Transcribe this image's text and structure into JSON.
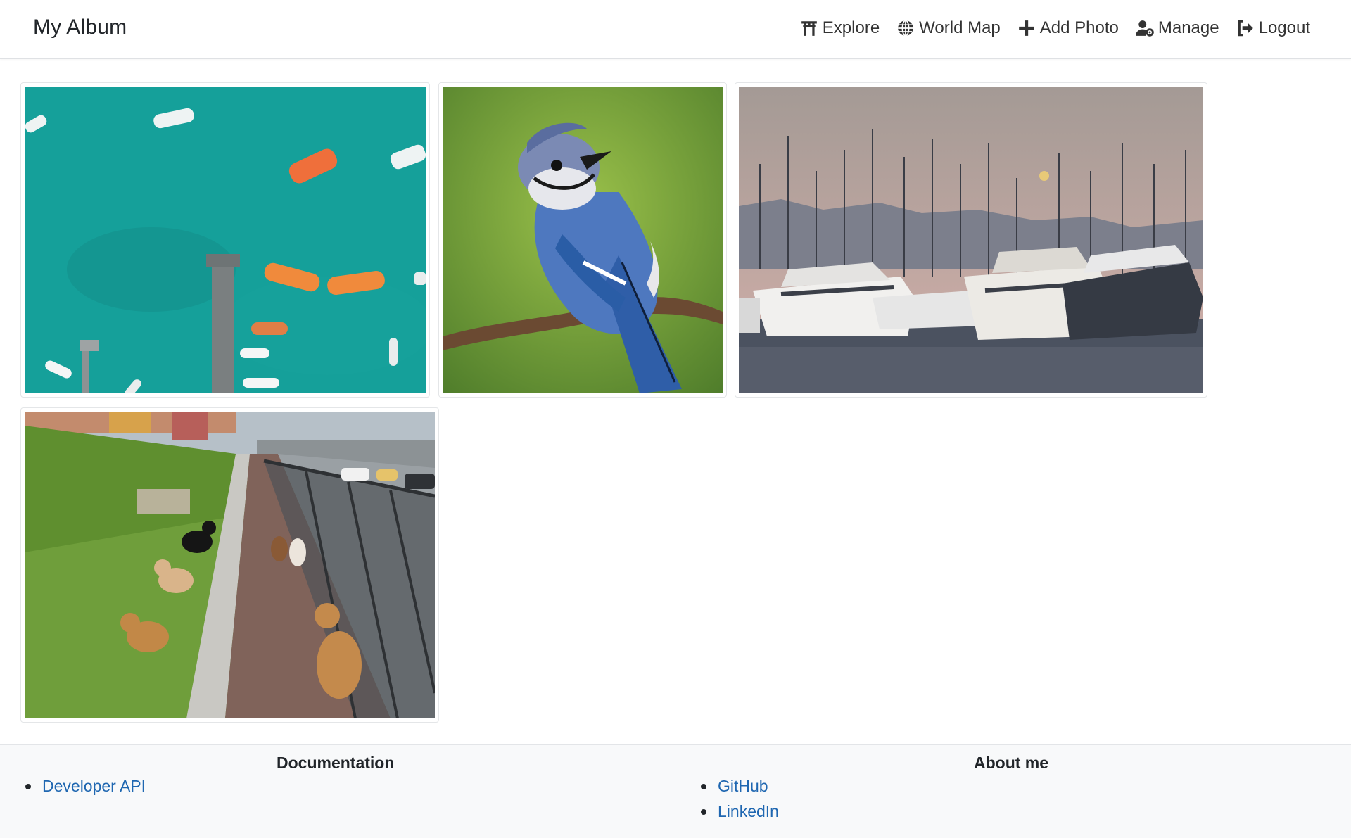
{
  "navbar": {
    "brand": "My Album",
    "links": [
      {
        "label": "Explore",
        "icon": "torii-gate-icon"
      },
      {
        "label": "World Map",
        "icon": "globe-icon"
      },
      {
        "label": "Add Photo",
        "icon": "plus-icon"
      },
      {
        "label": "Manage",
        "icon": "user-gear-icon"
      },
      {
        "label": "Logout",
        "icon": "sign-out-icon"
      }
    ]
  },
  "gallery": {
    "photos": [
      {
        "subject": "aerial-boats-turquoise-water"
      },
      {
        "subject": "blue-jay-bird-on-branch"
      },
      {
        "subject": "marina-yachts-sunset"
      },
      {
        "subject": "dogs-on-sidewalk"
      }
    ]
  },
  "footer": {
    "documentation": {
      "heading": "Documentation",
      "links": [
        "Developer API"
      ]
    },
    "about": {
      "heading": "About me",
      "links": [
        "GitHub",
        "LinkedIn"
      ]
    }
  },
  "colors": {
    "link": "#1f67b1",
    "footer_bg": "#f8f9fa",
    "text": "#212529"
  }
}
